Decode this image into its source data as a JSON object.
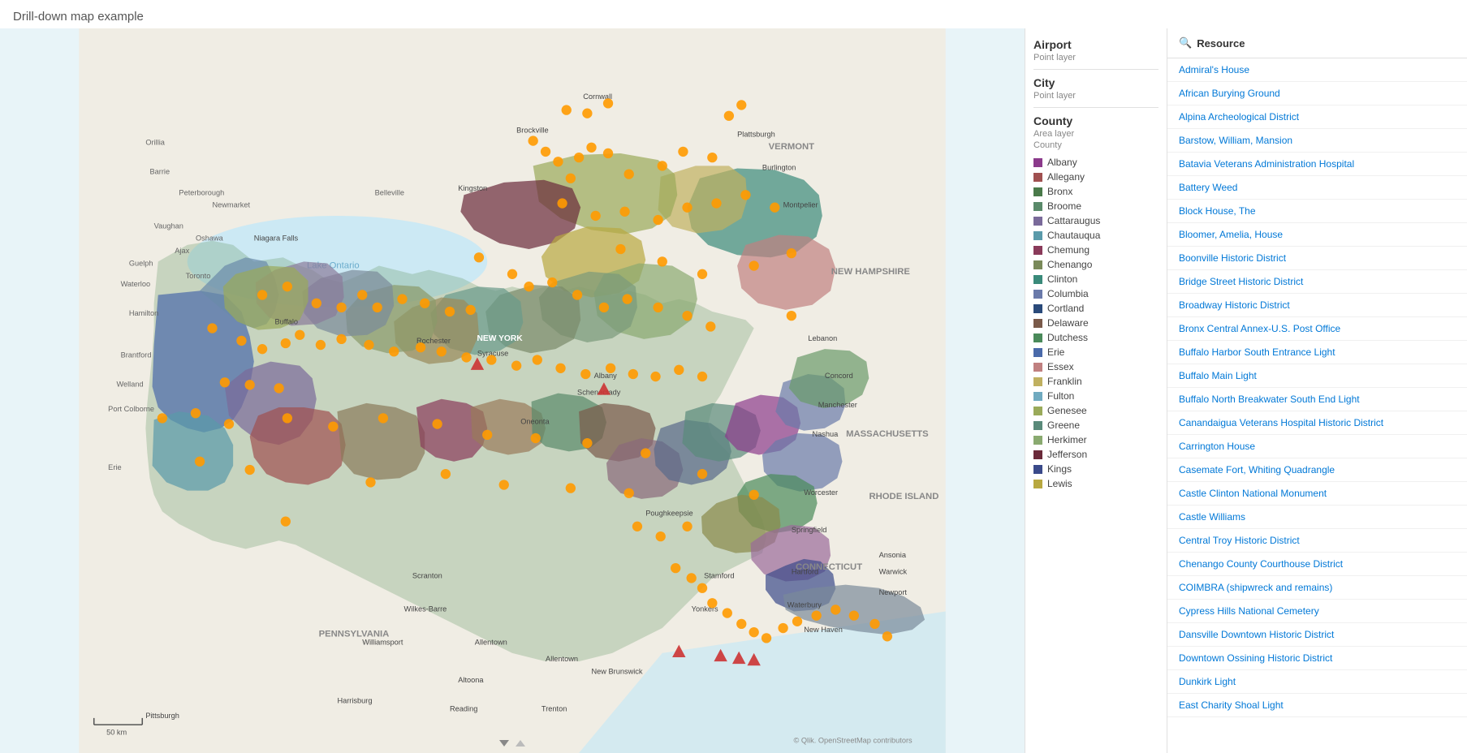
{
  "title": "Drill-down map example",
  "legend": {
    "airport": {
      "label": "Airport",
      "sublabel": "Point layer"
    },
    "city": {
      "label": "City",
      "sublabel": "Point layer"
    },
    "county": {
      "label": "County",
      "sublabel": "Area layer",
      "sublabel2": "County",
      "items": [
        {
          "name": "Albany",
          "color": "#8b3a8b"
        },
        {
          "name": "Allegany",
          "color": "#a05050"
        },
        {
          "name": "Bronx",
          "color": "#4a7a4a"
        },
        {
          "name": "Broome",
          "color": "#5a8a6a"
        },
        {
          "name": "Cattaraugus",
          "color": "#7a6a9a"
        },
        {
          "name": "Chautauqua",
          "color": "#5a9aaa"
        },
        {
          "name": "Chemung",
          "color": "#8a3a5a"
        },
        {
          "name": "Chenango",
          "color": "#7a8a5a"
        },
        {
          "name": "Clinton",
          "color": "#3a8a7a"
        },
        {
          "name": "Columbia",
          "color": "#6a7aaa"
        },
        {
          "name": "Cortland",
          "color": "#2a4a7a"
        },
        {
          "name": "Delaware",
          "color": "#7a5a4a"
        },
        {
          "name": "Dutchess",
          "color": "#4a8a5a"
        },
        {
          "name": "Erie",
          "color": "#4a6aaa"
        },
        {
          "name": "Essex",
          "color": "#c08080"
        },
        {
          "name": "Franklin",
          "color": "#c0b060"
        },
        {
          "name": "Fulton",
          "color": "#70aac0"
        },
        {
          "name": "Genesee",
          "color": "#9aaa5a"
        },
        {
          "name": "Greene",
          "color": "#5a8a7a"
        },
        {
          "name": "Herkimer",
          "color": "#8aaa70"
        },
        {
          "name": "Jefferson",
          "color": "#6a2a3a"
        },
        {
          "name": "Kings",
          "color": "#3a4a8a"
        },
        {
          "name": "Lewis",
          "color": "#b8a840"
        }
      ]
    }
  },
  "resource": {
    "header": "Resource",
    "items": [
      "Admiral's House",
      "African Burying Ground",
      "Alpina Archeological District",
      "Barstow, William, Mansion",
      "Batavia Veterans Administration Hospital",
      "Battery Weed",
      "Block House, The",
      "Bloomer, Amelia, House",
      "Boonville Historic District",
      "Bridge Street Historic District",
      "Broadway Historic District",
      "Bronx Central Annex-U.S. Post Office",
      "Buffalo Harbor South Entrance Light",
      "Buffalo Main Light",
      "Buffalo North Breakwater South End Light",
      "Canandaigua Veterans Hospital Historic District",
      "Carrington House",
      "Casemate Fort, Whiting Quadrangle",
      "Castle Clinton National Monument",
      "Castle Williams",
      "Central Troy Historic District",
      "Chenango County Courthouse District",
      "COIMBRA (shipwreck and remains)",
      "Cypress Hills National Cemetery",
      "Dansville Downtown Historic District",
      "Downtown Ossining Historic District",
      "Dunkirk Light",
      "East Charity Shoal Light"
    ]
  },
  "scale": "50 km",
  "attribution": "© Qlik. OpenStreetMap contributors"
}
